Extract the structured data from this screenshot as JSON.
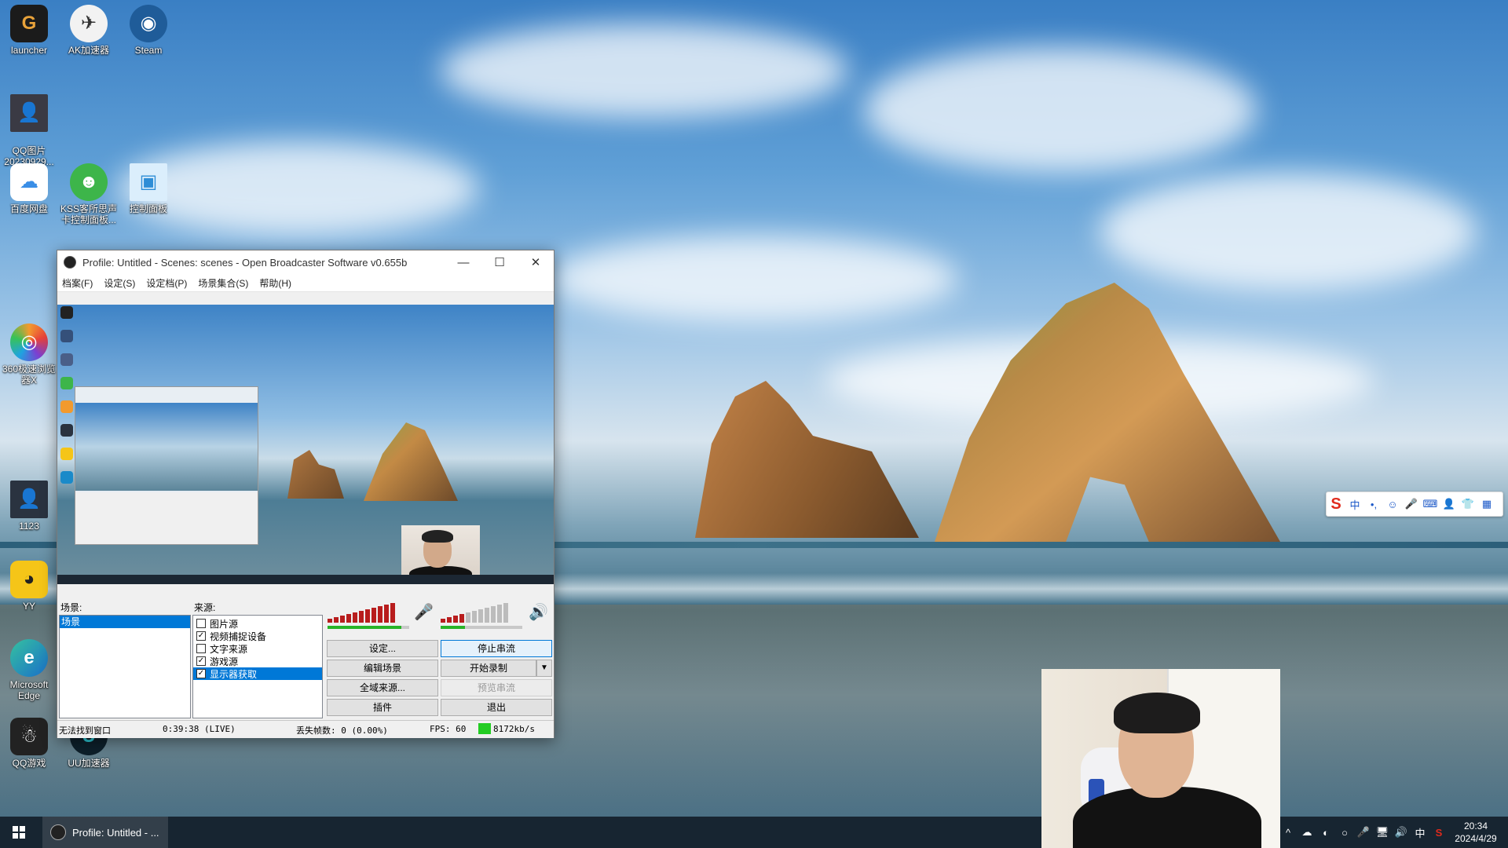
{
  "desktop": {
    "icons": [
      {
        "label": "launcher",
        "glyph": "G",
        "color": "#e8a23a"
      },
      {
        "label": "AK加速器",
        "glyph": "✈",
        "color": "#f2f2f2"
      },
      {
        "label": "Steam",
        "glyph": "◉",
        "color": "#1f5c99"
      },
      {
        "label": "QQ图片\n20230929...",
        "glyph": "👤",
        "color": "#555"
      },
      {
        "label": "百度网盘",
        "glyph": "☁",
        "color": "#3a8ee6"
      },
      {
        "label": "KSS客所思声卡控制面板...",
        "glyph": "☻",
        "color": "#3db54a"
      },
      {
        "label": "控制面板",
        "glyph": "▣",
        "color": "#2e8dd6"
      },
      {
        "label": "360极速浏览器X",
        "glyph": "◎",
        "color": "#f29a2e"
      },
      {
        "label": "1123",
        "glyph": "👤",
        "color": "#444"
      },
      {
        "label": "YY",
        "glyph": "◕",
        "color": "#f5c518"
      },
      {
        "label": "Microsoft Edge",
        "glyph": "e",
        "color": "#1a8ac9"
      },
      {
        "label": "QQ游戏",
        "glyph": "☃",
        "color": "#e84b3a"
      },
      {
        "label": "UU加速器",
        "glyph": "U",
        "color": "#2bc4d1"
      }
    ]
  },
  "obs": {
    "title": "Profile: Untitled - Scenes: scenes - Open Broadcaster Software v0.655b",
    "menu": [
      "档案(F)",
      "设定(S)",
      "设定档(P)",
      "场景集合(S)",
      "帮助(H)"
    ],
    "scenes_label": "场景:",
    "scenes": [
      "场景"
    ],
    "sources_label": "来源:",
    "sources": [
      {
        "label": "图片源",
        "checked": false,
        "selected": false
      },
      {
        "label": "视频捕捉设备",
        "checked": true,
        "selected": false
      },
      {
        "label": "文字来源",
        "checked": false,
        "selected": false
      },
      {
        "label": "游戏源",
        "checked": true,
        "selected": false
      },
      {
        "label": "显示器获取",
        "checked": true,
        "selected": true
      }
    ],
    "buttons": {
      "settings": "设定...",
      "stop_stream": "停止串流",
      "edit_scene": "编辑场景",
      "start_record": "开始录制",
      "global_sources": "全域来源...",
      "preview_stream": "预览串流",
      "plugins": "插件",
      "exit": "退出"
    },
    "status": {
      "window": "无法找到窗口",
      "time": "0:39:38 (LIVE)",
      "dropped": "丢失帧数: 0 (0.00%)",
      "fps": "FPS: 60",
      "bitrate": "8172kb/s",
      "bitrate_color": "#22cc22"
    },
    "mic_level": 0.9,
    "speaker_level": 0.3
  },
  "ime": {
    "items": [
      "S",
      "中",
      "•,",
      "☺",
      "🎤",
      "⌨",
      "👤",
      "👕",
      "▦"
    ]
  },
  "taskbar": {
    "task_label": "Profile: Untitled - ...",
    "tray_icons": [
      "^",
      "☁",
      "◐",
      "○",
      "🎤",
      "🖥",
      "🔊",
      "中",
      "S"
    ],
    "time": "20:34",
    "date": "2024/4/29"
  }
}
